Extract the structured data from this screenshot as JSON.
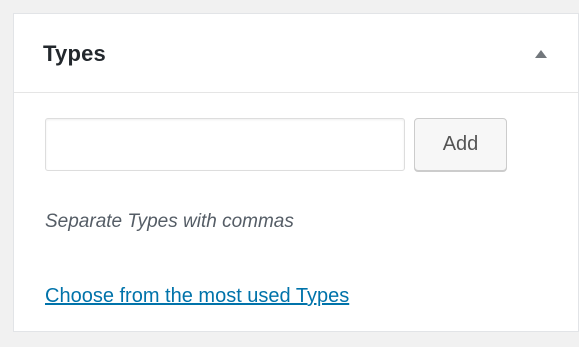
{
  "panel": {
    "title": "Types",
    "toggle_icon": "triangle-up-icon",
    "toggle_color": "#72777c"
  },
  "tag_input": {
    "value": "",
    "placeholder": ""
  },
  "add_button": {
    "label": "Add"
  },
  "hint": {
    "text": "Separate Types with commas"
  },
  "most_used_link": {
    "text": "Choose from the most used Types",
    "color": "#0073aa"
  }
}
